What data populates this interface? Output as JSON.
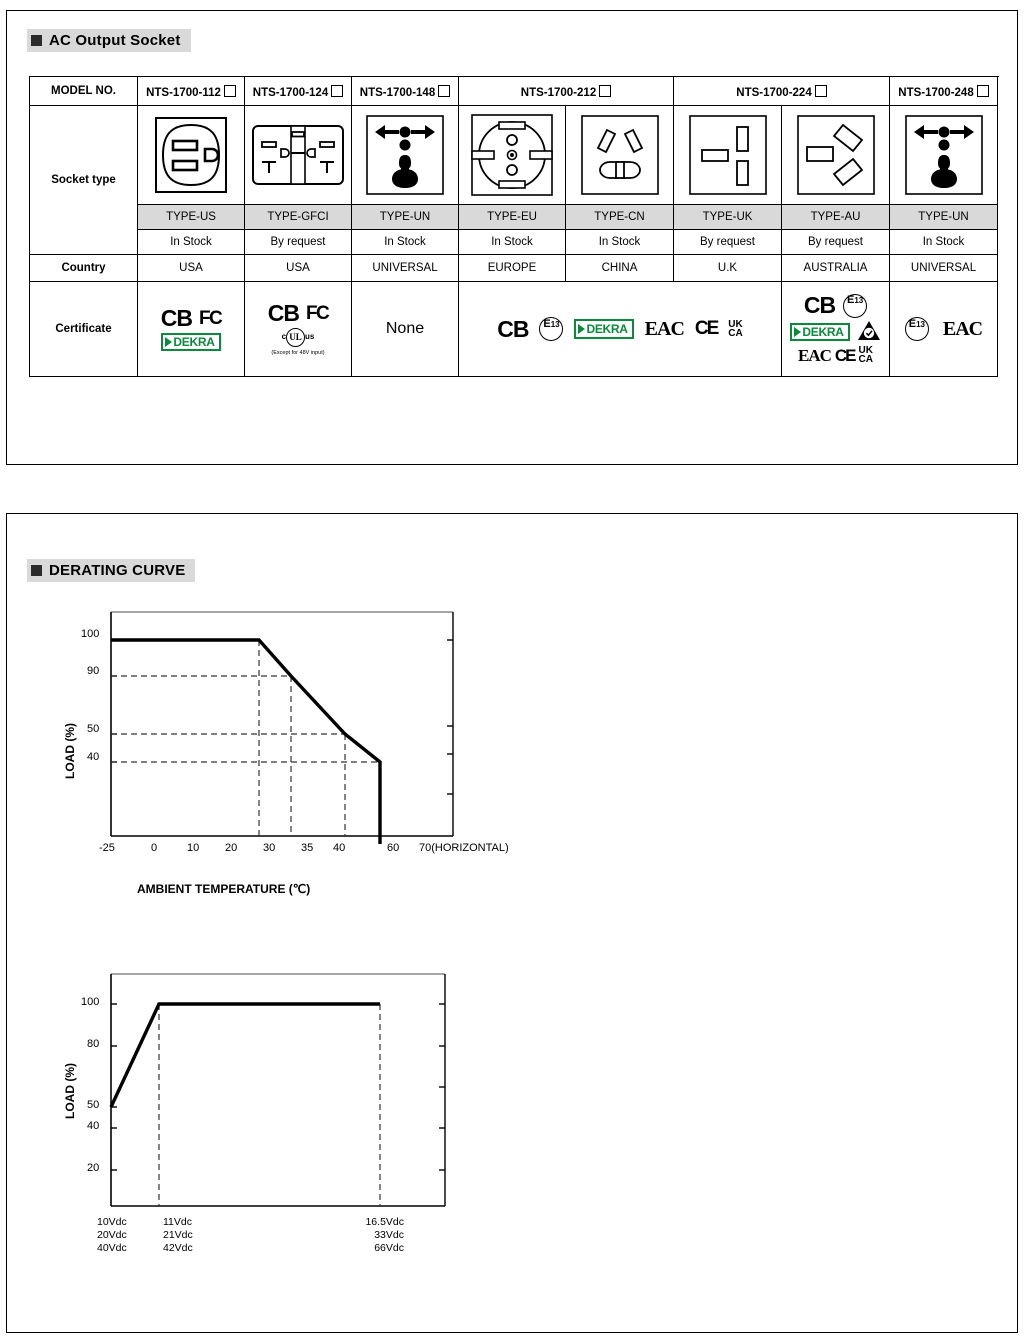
{
  "sections": {
    "socket_title": "AC Output Socket",
    "derating_title": "DERATING CURVE"
  },
  "socket_table": {
    "row_labels": {
      "model": "MODEL NO.",
      "socket_type": "Socket type",
      "country": "Country",
      "certificate": "Certificate"
    },
    "columns": [
      {
        "model": "NTS-1700-112",
        "type": "TYPE-US",
        "stock": "In Stock",
        "country": "USA",
        "socket": "us-socket-icon"
      },
      {
        "model": "NTS-1700-124",
        "type": "TYPE-GFCI",
        "stock": "By request",
        "country": "USA",
        "socket": "gfci-socket-icon"
      },
      {
        "model": "NTS-1700-148",
        "type": "TYPE-UN",
        "stock": "In Stock",
        "country": "UNIVERSAL",
        "socket": "universal-socket-icon"
      },
      {
        "model": "NTS-1700-212",
        "type": "TYPE-EU",
        "stock": "In Stock",
        "country": "EUROPE",
        "socket": "eu-socket-icon"
      },
      {
        "model": "NTS-1700-224",
        "type": "TYPE-CN",
        "stock": "In Stock",
        "country": "CHINA",
        "socket": "cn-socket-icon"
      },
      {
        "model": "NTS-1700-248",
        "type": "TYPE-UK",
        "stock": "By request",
        "country": "U.K",
        "socket": "uk-socket-icon"
      },
      {
        "model": "",
        "type": "TYPE-AU",
        "stock": "By request",
        "country": "AUSTRALIA",
        "socket": "au-socket-icon"
      },
      {
        "model": "",
        "type": "TYPE-UN",
        "stock": "In Stock",
        "country": "UNIVERSAL",
        "socket": "universal-socket-icon"
      }
    ],
    "certificates": {
      "cb": "CB",
      "fcc": "FC",
      "dekra": "DEKRA",
      "none": "None",
      "e13_letter": "E",
      "e13_num": "13",
      "eac": "EAC",
      "ce": "CE",
      "ukca_top": "UK",
      "ukca_bottom": "CA",
      "ul_c": "c",
      "ul_mark": "UL",
      "ul_us": "us",
      "ul_note": "(Except for 48V input)"
    }
  },
  "chart_data": [
    {
      "type": "line",
      "name": "temperature-derating",
      "title": "",
      "xlabel": "AMBIENT TEMPERATURE (℃)",
      "ylabel": "LOAD (%)",
      "x_ticks": [
        "-25",
        "0",
        "10",
        "20",
        "30",
        "35",
        "40",
        "60",
        "70(HORIZONTAL)"
      ],
      "y_ticks": [
        "100",
        "90",
        "50",
        "40"
      ],
      "ylim": [
        0,
        110
      ],
      "grid": "dashed",
      "points": [
        {
          "x": -25,
          "y": 100
        },
        {
          "x": 35,
          "y": 100
        },
        {
          "x": 40,
          "y": 90
        },
        {
          "x": 60,
          "y": 50
        },
        {
          "x": 67,
          "y": 40
        },
        {
          "x": 67,
          "y": 0
        }
      ],
      "guides": [
        {
          "x": 35,
          "y": 100
        },
        {
          "x": 40,
          "y": 90
        },
        {
          "x": 60,
          "y": 50
        },
        {
          "x": 67,
          "y": 40
        }
      ]
    },
    {
      "type": "line",
      "name": "input-voltage-derating",
      "title": "",
      "xlabel": "",
      "ylabel": "LOAD (%)",
      "y_ticks": [
        "100",
        "80",
        "50",
        "40",
        "20"
      ],
      "ylim": [
        0,
        112
      ],
      "grid": "dashed",
      "x_label_groups": [
        {
          "values": [
            "10Vdc",
            "20Vdc",
            "40Vdc"
          ],
          "align": "left"
        },
        {
          "values": [
            "11Vdc",
            "21Vdc",
            "42Vdc"
          ],
          "align": "left"
        },
        {
          "values": [
            "16.5Vdc",
            "33Vdc",
            "66Vdc"
          ],
          "align": "right"
        }
      ],
      "points": [
        {
          "label": "10Vdc",
          "y": 50
        },
        {
          "label": "11Vdc",
          "y": 100
        },
        {
          "label": "16.5Vdc",
          "y": 100
        }
      ],
      "guides": [
        "11Vdc",
        "16.5Vdc"
      ]
    }
  ]
}
